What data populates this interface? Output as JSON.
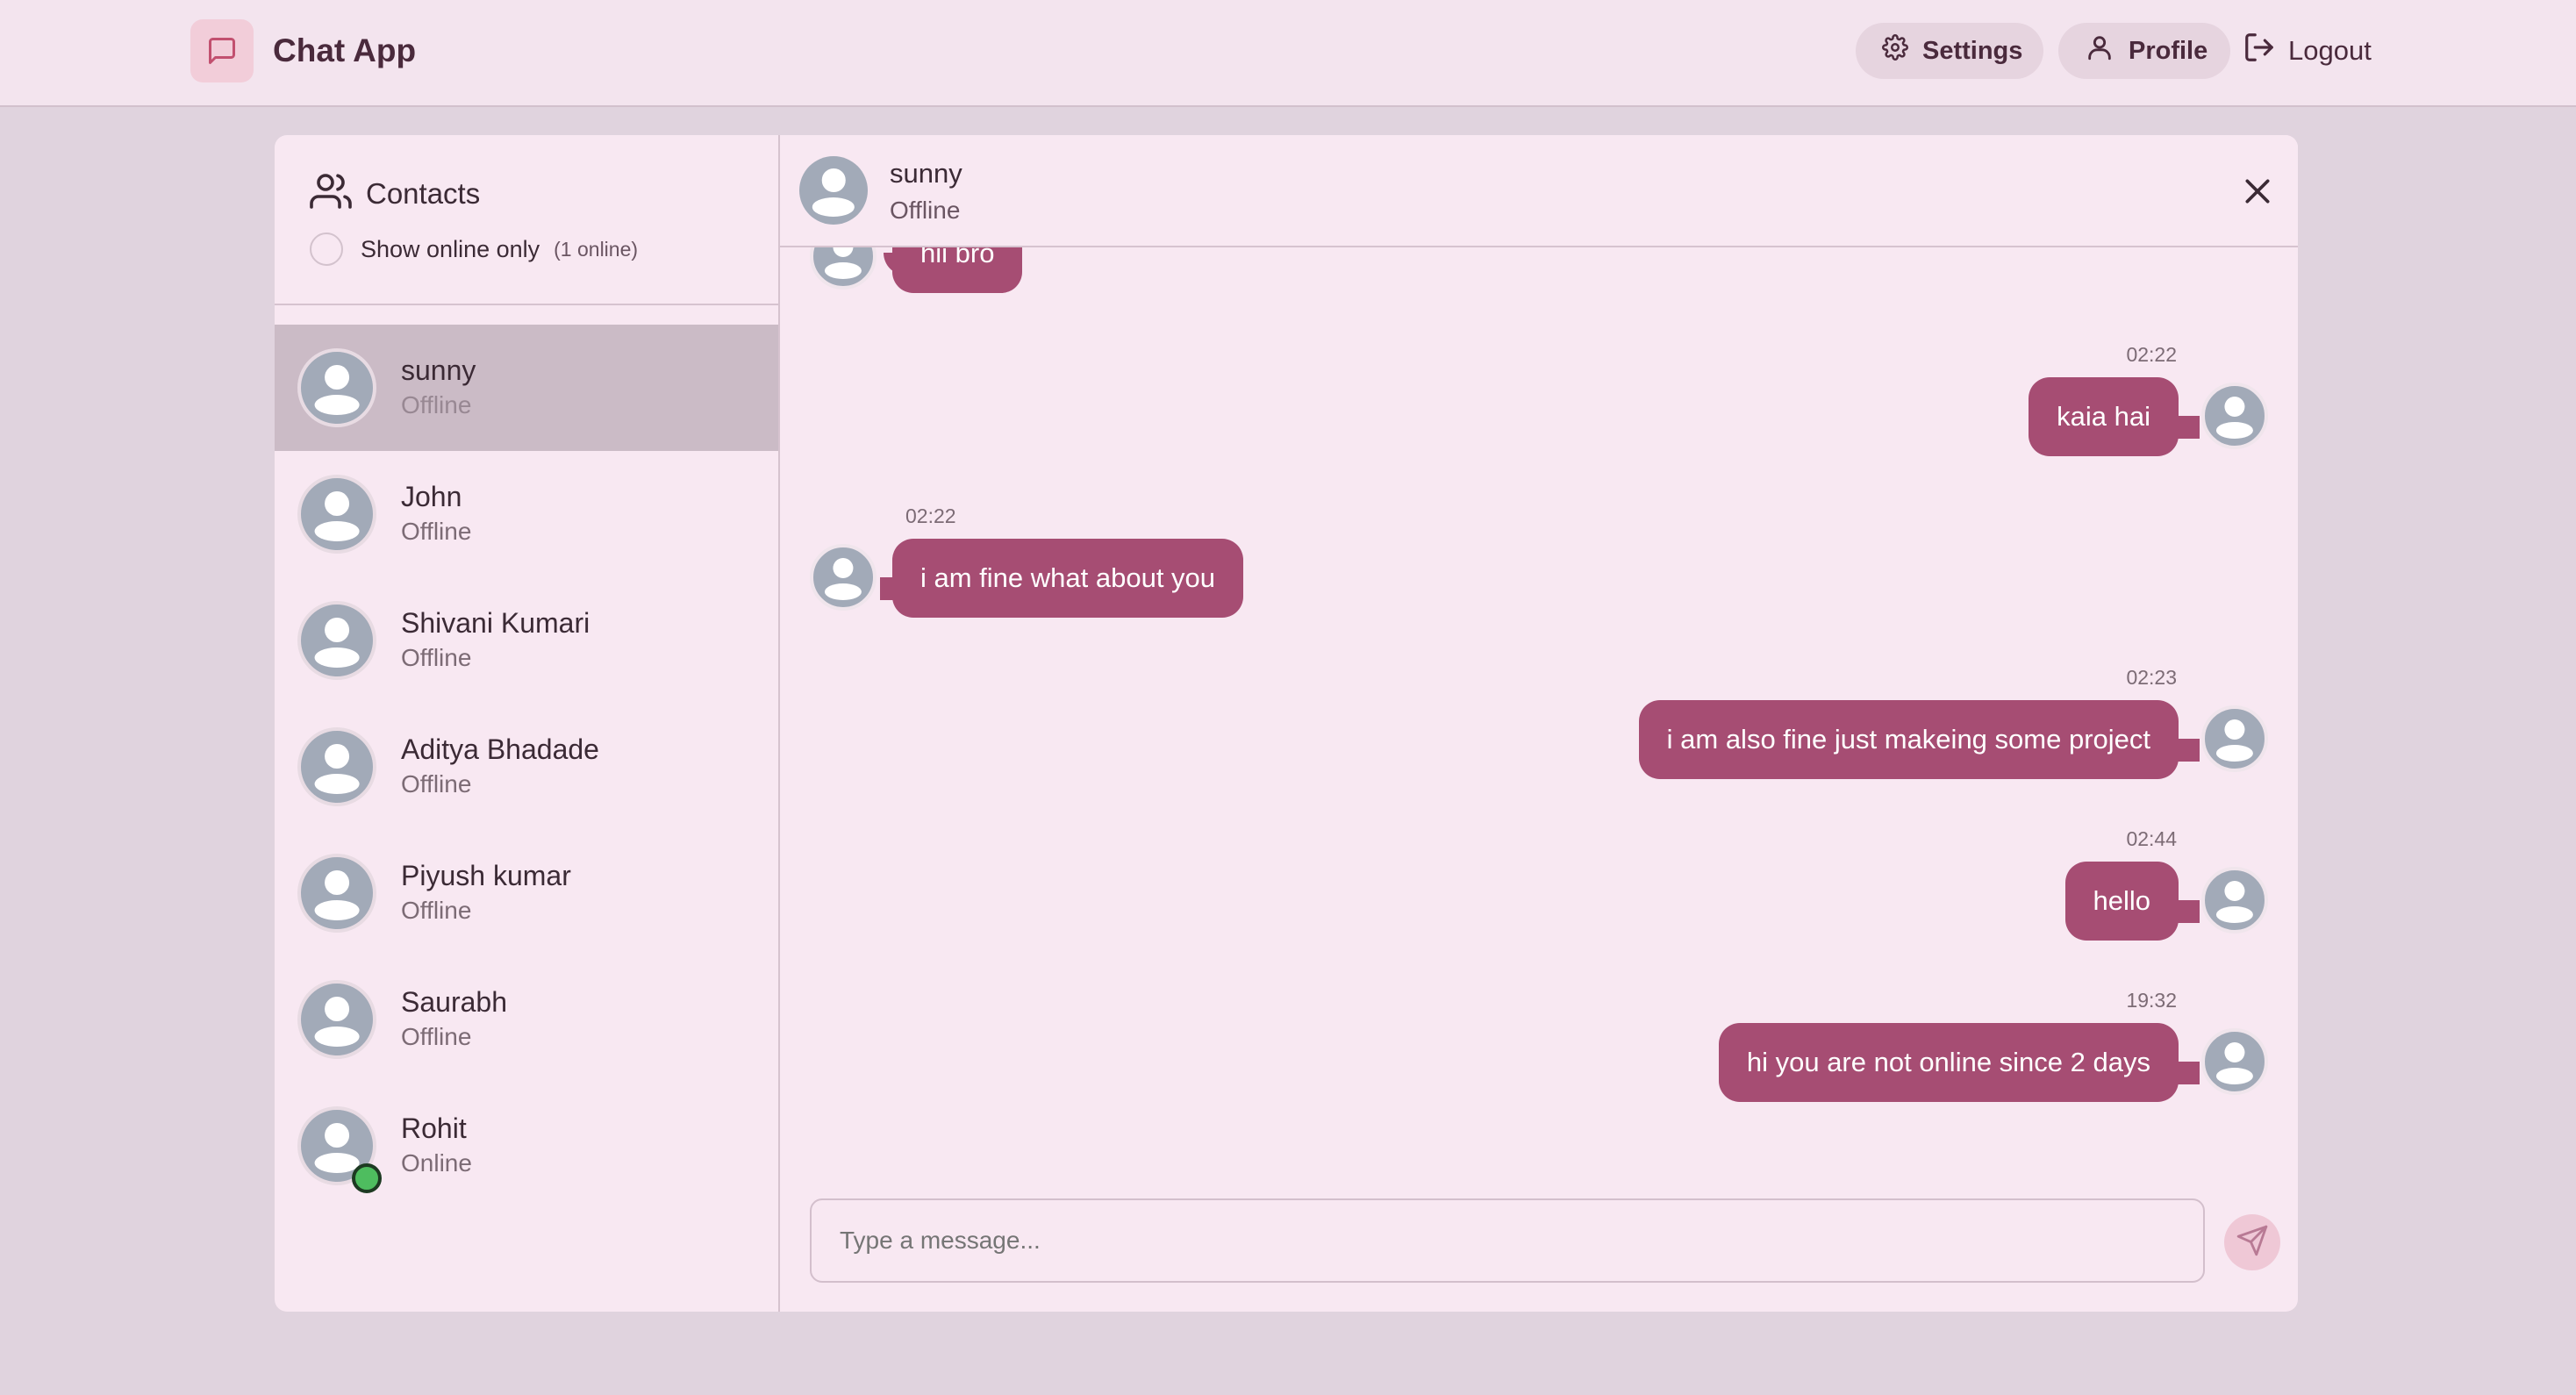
{
  "app": {
    "name": "Chat App"
  },
  "nav": {
    "settings": "Settings",
    "profile": "Profile",
    "logout": "Logout"
  },
  "contacts": {
    "title": "Contacts",
    "toggle_label": "Show online only",
    "online_count": "(1 online)",
    "items": [
      {
        "name": "sunny",
        "status": "Offline",
        "active": true
      },
      {
        "name": "John",
        "status": "Offline"
      },
      {
        "name": "Shivani Kumari",
        "status": "Offline"
      },
      {
        "name": "Aditya Bhadade",
        "status": "Offline"
      },
      {
        "name": "Piyush kumar",
        "status": "Offline"
      },
      {
        "name": "Saurabh",
        "status": "Offline"
      },
      {
        "name": "Rohit",
        "status": "Online"
      }
    ]
  },
  "chat": {
    "name": "sunny",
    "status": "Offline",
    "messages": [
      {
        "side": "in",
        "time": "",
        "text": "hii bro"
      },
      {
        "side": "out",
        "time": "02:22",
        "text": "kaia hai"
      },
      {
        "side": "in",
        "time": "02:22",
        "text": "i am fine what about you"
      },
      {
        "side": "out",
        "time": "02:23",
        "text": "i am also fine just makeing some project"
      },
      {
        "side": "out",
        "time": "02:44",
        "text": "hello"
      },
      {
        "side": "out",
        "time": "19:32",
        "text": "hi you are not online since 2 days"
      }
    ],
    "input_placeholder": "Type a message..."
  },
  "colors": {
    "accent": "#a64d73",
    "online": "#4ebd5f",
    "background": "#e0d3de",
    "panel": "#f8e8f2"
  },
  "icons": {
    "brand": "message-square-icon",
    "settings": "gear-icon",
    "profile": "user-icon",
    "logout": "logout-icon",
    "contacts": "users-icon",
    "close": "close-icon",
    "send": "send-icon"
  }
}
